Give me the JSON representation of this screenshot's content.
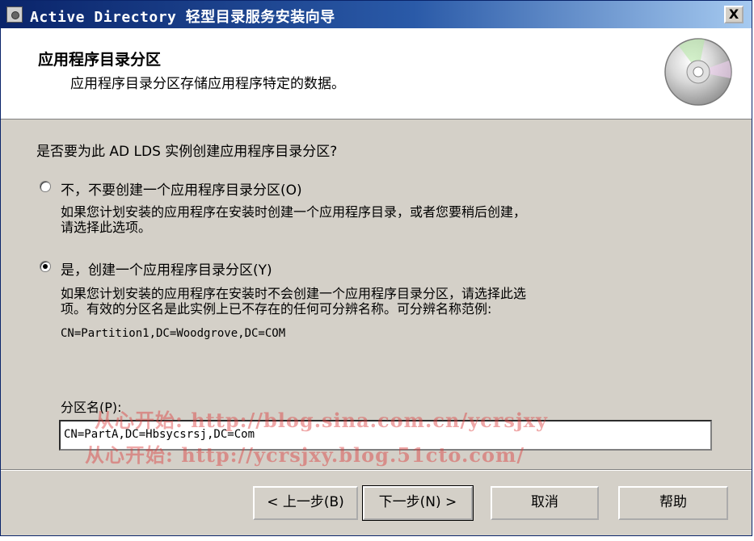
{
  "window": {
    "title": "Active Directory 轻型目录服务安装向导",
    "close_label": "X"
  },
  "header": {
    "title": "应用程序目录分区",
    "subtitle": "应用程序目录分区存储应用程序特定的数据。"
  },
  "question": "是否要为此 AD LDS 实例创建应用程序目录分区?",
  "options": [
    {
      "label": "不，不要创建一个应用程序目录分区(O)",
      "selected": false,
      "description_lines": [
        "如果您计划安装的应用程序在安装时创建一个应用程序目录，或者您要稍后创建，",
        "请选择此选项。"
      ]
    },
    {
      "label": "是，创建一个应用程序目录分区(Y)",
      "selected": true,
      "description_lines": [
        "如果您计划安装的应用程序在安装时不会创建一个应用程序目录分区，请选择此选",
        "项。有效的分区名是此实例上已不存在的任何可分辨名称。可分辨名称范例:"
      ],
      "example": "CN=Partition1,DC=Woodgrove,DC=COM"
    }
  ],
  "partition": {
    "label": "分区名(P):",
    "value": "CN=PartA,DC=Hbsycsrsj,DC=Com"
  },
  "watermark": {
    "line1": "从心开始: http://blog.sina.com.cn/ycrsjxy",
    "line2": "从心开始: http://ycrsjxy.blog.51cto.com/"
  },
  "buttons": {
    "back": "< 上一步(B)",
    "next": "下一步(N) >",
    "cancel": "取消",
    "help": "帮助"
  }
}
